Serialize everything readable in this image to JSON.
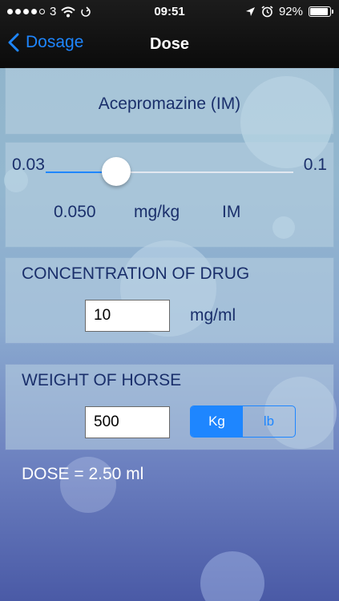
{
  "status": {
    "carrier": "3",
    "time": "09:51",
    "battery_label": "92%",
    "battery_fraction": 0.92
  },
  "nav": {
    "back_label": "Dosage",
    "title": "Dose"
  },
  "drug": {
    "name": "Acepromazine (IM)"
  },
  "slider": {
    "min_label": "0.03",
    "max_label": "0.1",
    "min": 0.03,
    "max": 0.1,
    "value": 0.05,
    "value_label": "0.050",
    "unit": "mg/kg",
    "route": "IM"
  },
  "concentration": {
    "title": "CONCENTRATION OF DRUG",
    "value": "10",
    "unit": "mg/ml"
  },
  "weight": {
    "title": "WEIGHT OF HORSE",
    "value": "500",
    "unit_options": [
      "Kg",
      "lb"
    ],
    "selected_unit": "Kg"
  },
  "result": {
    "text": "DOSE = 2.50 ml"
  },
  "colors": {
    "accent": "#1e86ff",
    "label_text": "#1a2f6b"
  }
}
